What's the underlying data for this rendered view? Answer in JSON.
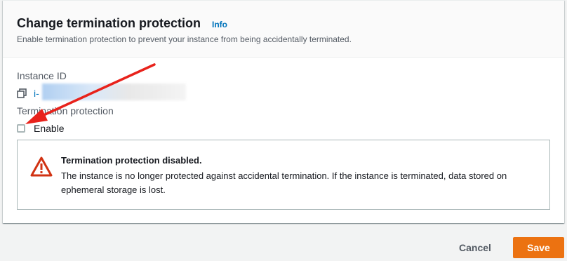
{
  "header": {
    "title": "Change termination protection",
    "info_link": "Info",
    "description": "Enable termination protection to prevent your instance from being accidentally terminated."
  },
  "instance": {
    "label": "Instance ID",
    "id_visible": "i-",
    "copy_icon": "copy-icon"
  },
  "termination": {
    "label": "Termination protection",
    "checkbox_label": "Enable",
    "checked": false
  },
  "alert": {
    "icon": "warning-triangle-icon",
    "title": "Termination protection disabled.",
    "body": "The instance is no longer protected against accidental termination. If the instance is terminated, data stored on ephemeral storage is lost."
  },
  "footer": {
    "cancel_label": "Cancel",
    "save_label": "Save"
  },
  "colors": {
    "accent": "#ec7211",
    "link": "#0073bb",
    "warning": "#d13212",
    "annotation_arrow": "#e8221b"
  }
}
